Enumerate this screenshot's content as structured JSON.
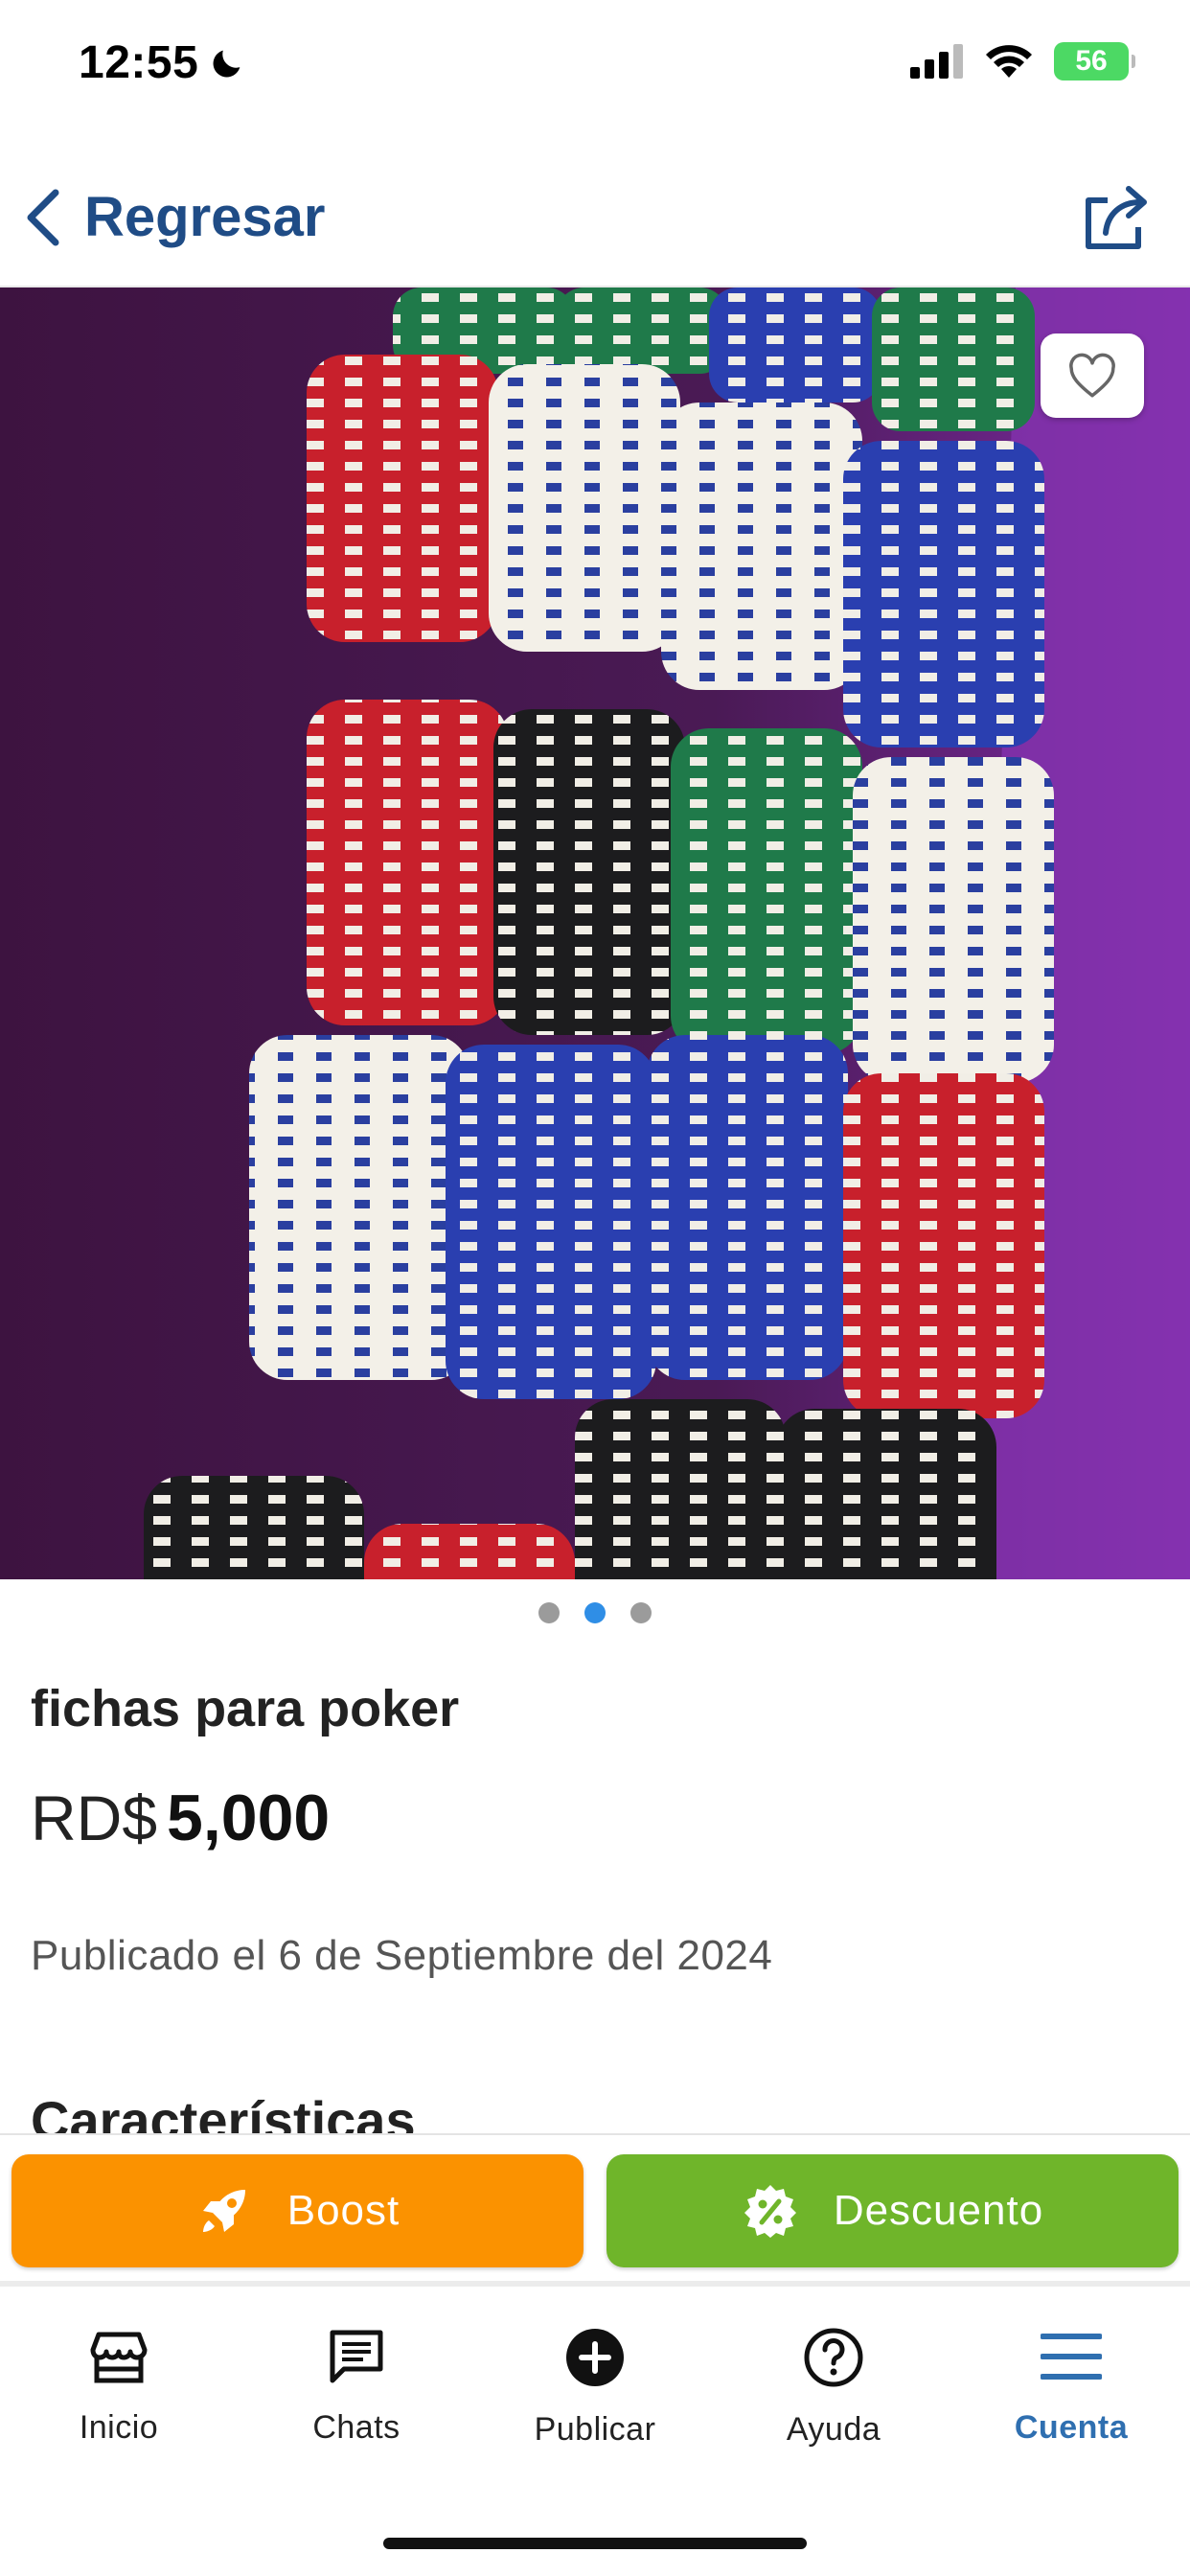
{
  "status_bar": {
    "time": "12:55",
    "battery": "56"
  },
  "nav": {
    "back_label": "Regresar"
  },
  "listing": {
    "title": "fichas para poker",
    "currency": "RD$",
    "price": "5,000",
    "published": "Publicado el 6 de Septiembre del 2024",
    "section_heading": "Características",
    "image_count": 3,
    "active_image_index": 1
  },
  "actions": {
    "boost_label": "Boost",
    "discount_label": "Descuento"
  },
  "tabs": [
    {
      "label": "Inicio",
      "icon": "store-icon"
    },
    {
      "label": "Chats",
      "icon": "chat-icon"
    },
    {
      "label": "Publicar",
      "icon": "plus-circle-icon"
    },
    {
      "label": "Ayuda",
      "icon": "help-icon"
    },
    {
      "label": "Cuenta",
      "icon": "menu-icon",
      "active": true
    }
  ],
  "colors": {
    "brand_blue": "#1f4c86",
    "boost_orange": "#fb9200",
    "discount_green": "#6fb52a",
    "dot_active": "#2f8ee6",
    "tab_active": "#2f6fb0"
  }
}
